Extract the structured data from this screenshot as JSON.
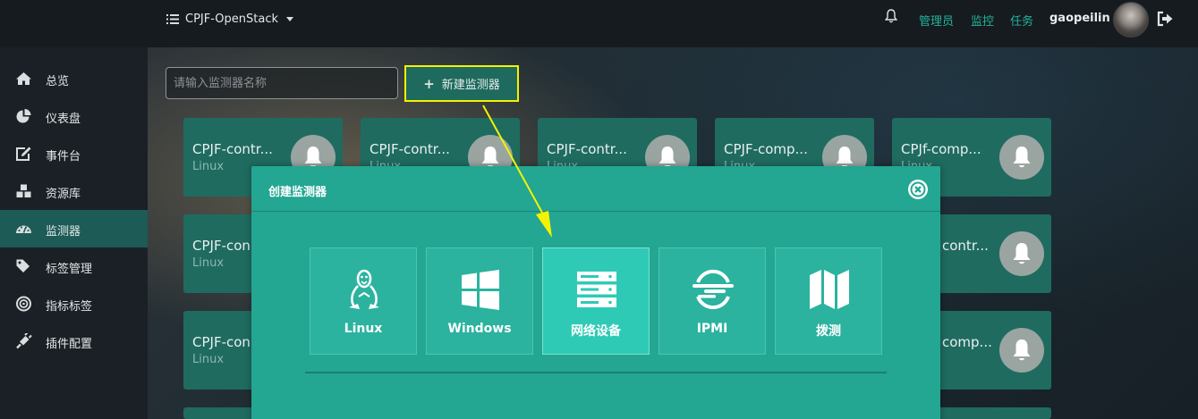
{
  "topbar": {
    "project": "CPJF-OpenStack",
    "links": [
      "管理员",
      "监控",
      "任务"
    ],
    "username": "gaopeilin",
    "icons": {
      "menu": "list-icon",
      "bell": "bell-icon",
      "logout": "logout-icon"
    }
  },
  "sidebar": {
    "items": [
      {
        "label": "总览",
        "icon": "home-icon"
      },
      {
        "label": "仪表盘",
        "icon": "pie-chart-icon"
      },
      {
        "label": "事件台",
        "icon": "edit-icon"
      },
      {
        "label": "资源库",
        "icon": "cubes-icon"
      },
      {
        "label": "监测器",
        "icon": "dashboard-icon",
        "active": true
      },
      {
        "label": "标签管理",
        "icon": "tags-icon"
      },
      {
        "label": "指标标签",
        "icon": "target-icon"
      },
      {
        "label": "插件配置",
        "icon": "plug-icon"
      }
    ]
  },
  "toolbar": {
    "search_placeholder": "请输入监测器名称",
    "new_button": "新建监测器"
  },
  "cards": [
    {
      "title": "CPJF-contr...",
      "os": "Linux"
    },
    {
      "title": "CPJF-contr...",
      "os": "Linux"
    },
    {
      "title": "CPJF-contr...",
      "os": "Linux"
    },
    {
      "title": "CPJF-comp...",
      "os": "Linux"
    },
    {
      "title": "CPJf-comp...",
      "os": "Linux"
    },
    {
      "title": "CPJF-con",
      "os": "Linux"
    },
    {
      "title": "contr...",
      "os": ""
    },
    {
      "title": "CPJF-con",
      "os": "Linux"
    },
    {
      "title": "comp...",
      "os": ""
    }
  ],
  "modal": {
    "title": "创建监测器",
    "options": [
      {
        "label": "Linux",
        "icon": "linux-icon"
      },
      {
        "label": "Windows",
        "icon": "windows-icon"
      },
      {
        "label": "网络设备",
        "icon": "server-icon",
        "selected": true
      },
      {
        "label": "IPMI",
        "icon": "ipmi-icon"
      },
      {
        "label": "拨测",
        "icon": "map-icon"
      }
    ]
  },
  "colors": {
    "accent": "#21b49b",
    "highlight": "#f3f300",
    "modal_bg": "#23a692",
    "card_bg": "#1f6b60"
  }
}
